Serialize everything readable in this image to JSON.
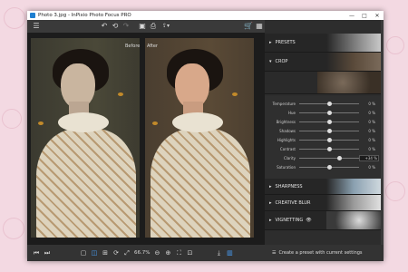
{
  "window": {
    "title": "Photo 3.jpg - InPixio Photo Focus PRO",
    "minimize_glyph": "—",
    "maximize_glyph": "□",
    "close_glyph": "✕"
  },
  "toolbar": {
    "menu_icon": "hamburger-icon",
    "undo_icon": "undo-icon",
    "undo_all_icon": "undo-all-icon",
    "redo_icon": "redo-icon",
    "save_icon": "save-icon",
    "print_icon": "print-icon",
    "share_icon": "share-icon",
    "cart_icon": "cart-icon",
    "grid_icon": "grid-icon",
    "before_label": "Before",
    "after_label": "After"
  },
  "panel": {
    "presets_label": "PRESETS",
    "crop_label": "CROP",
    "sharpness_label": "SHARPNESS",
    "creative_blur_label": "CREATIVE BLUR",
    "vignetting_label": "VIGNETTING",
    "adjustments": [
      {
        "label": "Temperature",
        "value": "0 %",
        "level": 0.5
      },
      {
        "label": "Hue",
        "value": "0 %",
        "level": 0.5
      },
      {
        "label": "Brightness",
        "value": "0 %",
        "level": 0.5
      },
      {
        "label": "Shadows",
        "value": "0 %",
        "level": 0.5
      },
      {
        "label": "Highlights",
        "value": "0 %",
        "level": 0.5
      },
      {
        "label": "Contrast",
        "value": "0 %",
        "level": 0.5
      },
      {
        "label": "Clarity",
        "value": "+34 %",
        "level": 0.67
      },
      {
        "label": "Saturation",
        "value": "0 %",
        "level": 0.5
      }
    ]
  },
  "bottombar": {
    "zoom_value": "66.7%",
    "preset_button_label": "Create a preset with current settings"
  }
}
